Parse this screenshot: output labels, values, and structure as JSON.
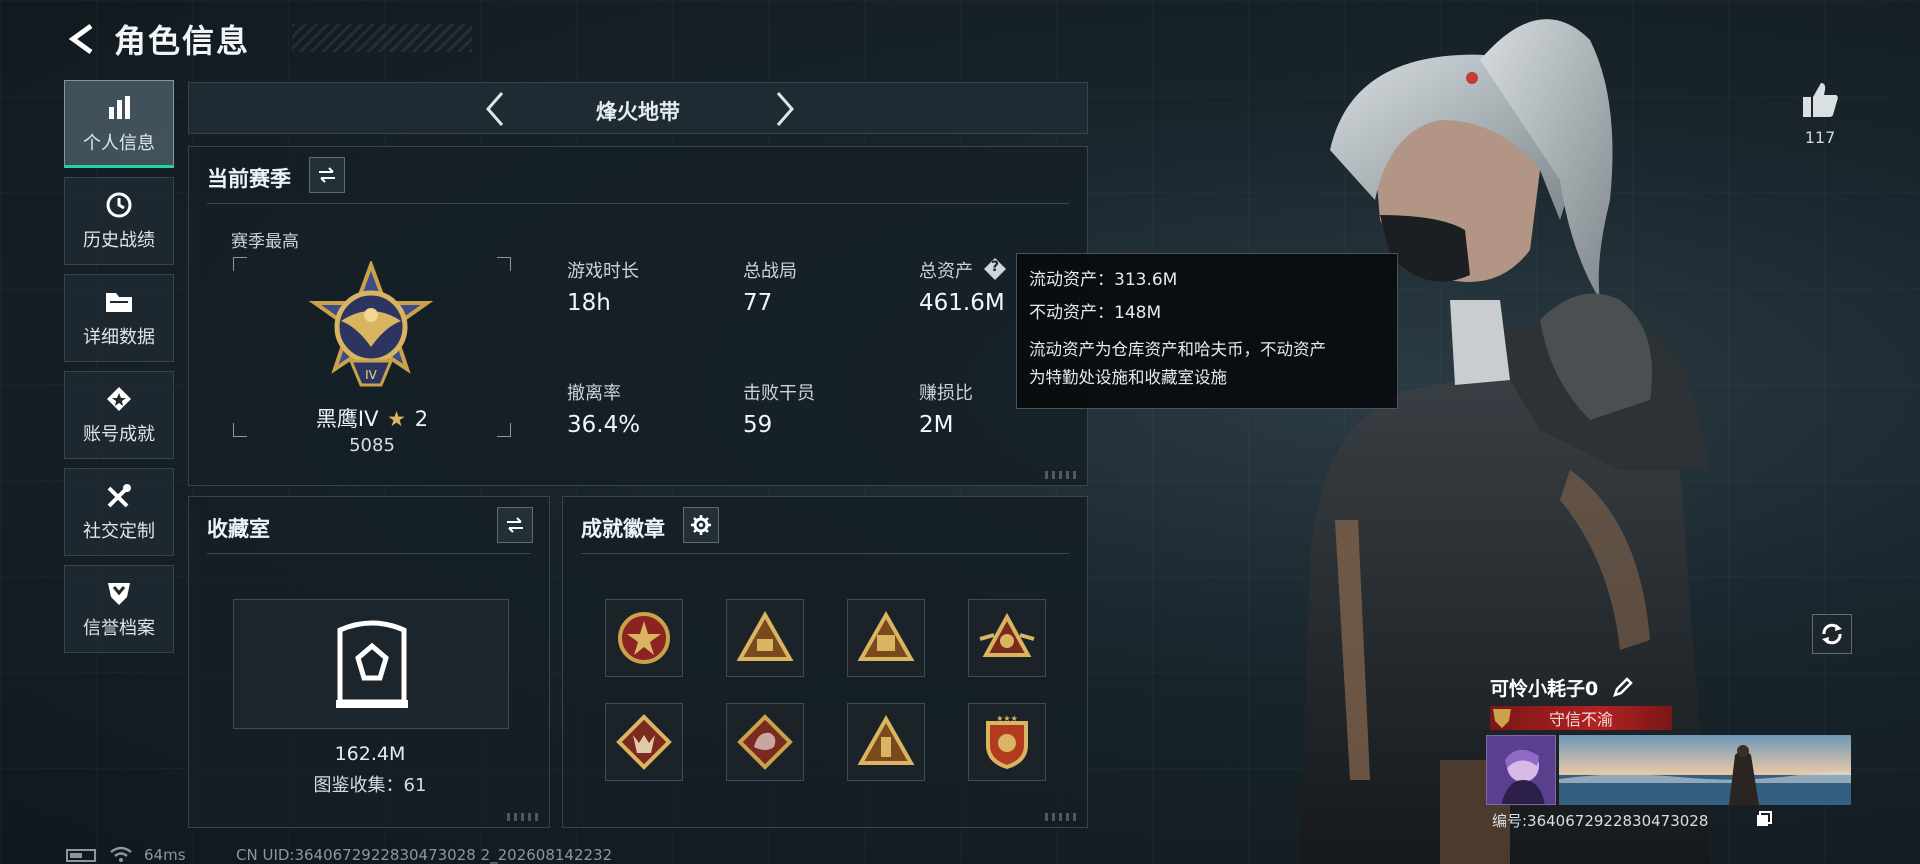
{
  "header": {
    "title": "角色信息"
  },
  "nav": {
    "items": [
      {
        "label": "个人信息",
        "icon": "bar-chart-icon",
        "active": true
      },
      {
        "label": "历史战绩",
        "icon": "history-icon",
        "active": false
      },
      {
        "label": "详细数据",
        "icon": "folder-icon",
        "active": false
      },
      {
        "label": "账号成就",
        "icon": "achievement-icon",
        "active": false
      },
      {
        "label": "社交定制",
        "icon": "tools-icon",
        "active": false
      },
      {
        "label": "信誉档案",
        "icon": "credit-shield-icon",
        "active": false
      }
    ]
  },
  "mode": {
    "title": "烽火地带"
  },
  "season": {
    "title": "当前赛季",
    "best_label": "赛季最高",
    "rank_name": "黑鹰IV",
    "rank_stars": "2",
    "rank_score": "5085",
    "stats": [
      {
        "label": "游戏时长",
        "value": "18h"
      },
      {
        "label": "总战局",
        "value": "77"
      },
      {
        "label": "总资产",
        "value": "461.6M"
      },
      {
        "label": "撤离率",
        "value": "36.4%"
      },
      {
        "label": "击败干员",
        "value": "59"
      },
      {
        "label": "赚损比",
        "value": "2M"
      }
    ],
    "help_icon": "?"
  },
  "tooltip": {
    "liquid": "流动资产：313.6M",
    "fixed": "不动资产：148M",
    "desc_line1": "流动资产为仓库资产和哈夫币，不动资产",
    "desc_line2": "为特勤处设施和收藏室设施"
  },
  "collection": {
    "title": "收藏室",
    "value": "162.4M",
    "catalog": "图鉴收集：61"
  },
  "achievements": {
    "title": "成就徽章",
    "badges": [
      {
        "icon": "star-shield-badge-icon"
      },
      {
        "icon": "triangle-map-badge-icon"
      },
      {
        "icon": "triangle-58-badge-icon"
      },
      {
        "icon": "winged-triangle-badge-icon"
      },
      {
        "icon": "wolf-diamond-badge-icon"
      },
      {
        "icon": "dragon-diamond-badge-icon"
      },
      {
        "icon": "tower-triangle-badge-icon"
      },
      {
        "icon": "shield-stars-badge-icon"
      }
    ]
  },
  "profile": {
    "likes": "117",
    "name": "可怜小耗子0",
    "title": "守信不渝",
    "uid_line": "编号:3640672922830473028"
  },
  "footer": {
    "ping": "64ms",
    "cn_uid": "CN UID:3640672922830473028 2_202608142232"
  },
  "colors": {
    "accent": "#1fd6a4",
    "gold": "#c9a24a",
    "title_red": "#b22323"
  }
}
